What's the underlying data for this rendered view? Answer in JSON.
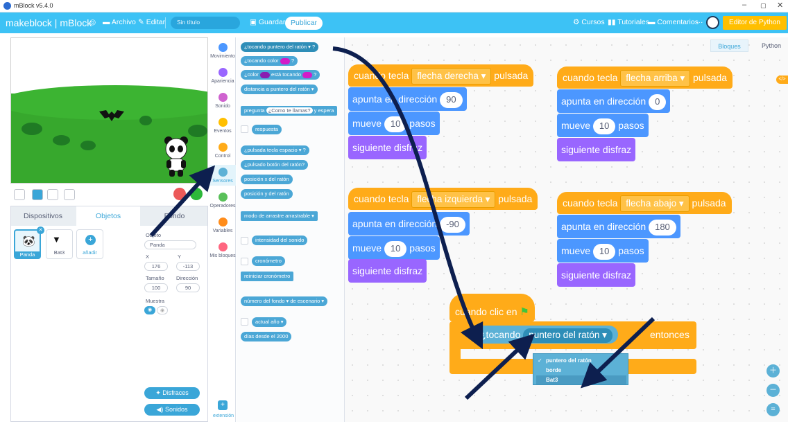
{
  "window": {
    "title": "mBlock v5.4.0",
    "minimize": "–",
    "maximize": "▢",
    "close": "✕"
  },
  "menubar": {
    "brand": "makeblock | mBlock",
    "items": [
      "Archivo",
      "Editar"
    ],
    "project_title": "Sin título",
    "save": "Guardar",
    "publish": "Publicar",
    "right_items": [
      "Cursos",
      "Tutoriales",
      "Comentarios",
      "···"
    ],
    "python_editor": "Editor de Python"
  },
  "sprite_panel": {
    "tabs": [
      "Dispositivos",
      "Objetos",
      "Fondo"
    ],
    "active_tab": "Objetos",
    "sprites": [
      {
        "name": "Panda",
        "selected": true
      },
      {
        "name": "Bat3",
        "selected": false
      }
    ],
    "add_label": "añadir",
    "props": {
      "object_label": "Objeto",
      "object_value": "Panda",
      "x_label": "X",
      "x_value": "176",
      "y_label": "Y",
      "y_value": "-113",
      "size_label": "Tamaño",
      "size_value": "100",
      "direction_label": "Dirección",
      "direction_value": "90",
      "show_label": "Muestra"
    },
    "costumes_button": "Disfraces",
    "sounds_button": "Sonidos"
  },
  "categories": [
    {
      "label": "Movimiento",
      "color": "#4c97ff"
    },
    {
      "label": "Apariencia",
      "color": "#9966ff"
    },
    {
      "label": "Sonido",
      "color": "#cf63cf"
    },
    {
      "label": "Eventos",
      "color": "#ffbf00"
    },
    {
      "label": "Control",
      "color": "#ffab19"
    },
    {
      "label": "Sensores",
      "color": "#5cb1d6",
      "active": true
    },
    {
      "label": "Operadores",
      "color": "#59c059"
    },
    {
      "label": "Variables",
      "color": "#ff8c1a"
    },
    {
      "label": "Mis bloques",
      "color": "#ff6680"
    }
  ],
  "extension_label": "extensión",
  "palette": {
    "b1": "¿tocando",
    "b1_dd": "puntero del ratón ▾",
    "b1_end": "?",
    "b2": "¿tocando color",
    "b2_end": "?",
    "b3": "¿color",
    "b3_mid": "está tocando",
    "b3_end": "?",
    "b4": "distancia a",
    "b4_dd": "puntero del ratón ▾",
    "b5": "pregunta",
    "b5_in": "¿Como te llamas?",
    "b5_end": "y espera",
    "b6": "respuesta",
    "b7": "¿pulsada tecla",
    "b7_dd": "espacio ▾",
    "b7_end": "?",
    "b8": "¿pulsado botón del ratón?",
    "b9": "posición x del ratón",
    "b10": "posición y del ratón",
    "b11": "modo de arrastre",
    "b11_dd": "arrastrable ▾",
    "b12": "intensidad del sonido",
    "b13": "cronómetro",
    "b14": "reiniciar cronómetro",
    "b15": "número del fondo ▾",
    "b15_mid": "de",
    "b15_dd": "escenario ▾",
    "b16": "actual",
    "b16_dd": "año ▾",
    "b17": "días desde el 2000"
  },
  "workspace": {
    "tabs": {
      "blocks": "Bloques",
      "python": "Python"
    },
    "script1": {
      "hat": "cuando tecla",
      "key": "flecha derecha ▾",
      "hat_end": "pulsada",
      "point": "apunta en dirección",
      "dir": "90",
      "move": "mueve",
      "steps": "10",
      "steps_label": "pasos",
      "next": "siguiente disfraz"
    },
    "script2": {
      "hat": "cuando tecla",
      "key": "flecha arriba ▾",
      "hat_end": "pulsada",
      "point": "apunta en dirección",
      "dir": "0",
      "move": "mueve",
      "steps": "10",
      "steps_label": "pasos",
      "next": "siguiente disfraz"
    },
    "script3": {
      "hat": "cuando tecla",
      "key": "flecha izquierda ▾",
      "hat_end": "pulsada",
      "point": "apunta en dirección",
      "dir": "-90",
      "move": "mueve",
      "steps": "10",
      "steps_label": "pasos",
      "next": "siguiente disfraz"
    },
    "script4": {
      "hat": "cuando tecla",
      "key": "flecha abajo ▾",
      "hat_end": "pulsada",
      "point": "apunta en dirección",
      "dir": "180",
      "move": "mueve",
      "steps": "10",
      "steps_label": "pasos",
      "next": "siguiente disfraz"
    },
    "script5": {
      "hat": "cuando clic en",
      "if_label": "si",
      "cond": "¿tocando",
      "cond_dd": "puntero del ratón ▾",
      "then": "entonces"
    },
    "dropdown": {
      "options": [
        "puntero del ratón",
        "borde",
        "Bat3"
      ],
      "checked": "puntero del ratón",
      "highlighted": "Bat3"
    }
  },
  "colors": {
    "menubar": "#3dc2f5",
    "motion": "#4c97ff",
    "looks": "#9966ff",
    "events": "#ffab19",
    "sensing": "#5cb1d6",
    "arrow": "#0d1f4f"
  }
}
